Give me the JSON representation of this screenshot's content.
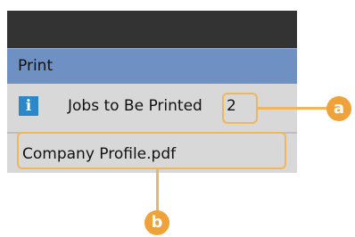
{
  "screen": {
    "title": "Print",
    "info_icon": "info-icon",
    "jobs_label": "Jobs to Be Printed",
    "jobs_count": "2",
    "file_name": "Company Profile.pdf"
  },
  "callouts": {
    "a": "a",
    "b": "b"
  },
  "colors": {
    "header_bar": "#6e90c2",
    "row_background": "#d8d8d8",
    "screen_frame": "#333333",
    "callout_accent": "#f0a23a",
    "info_icon": "#2d86c8"
  }
}
